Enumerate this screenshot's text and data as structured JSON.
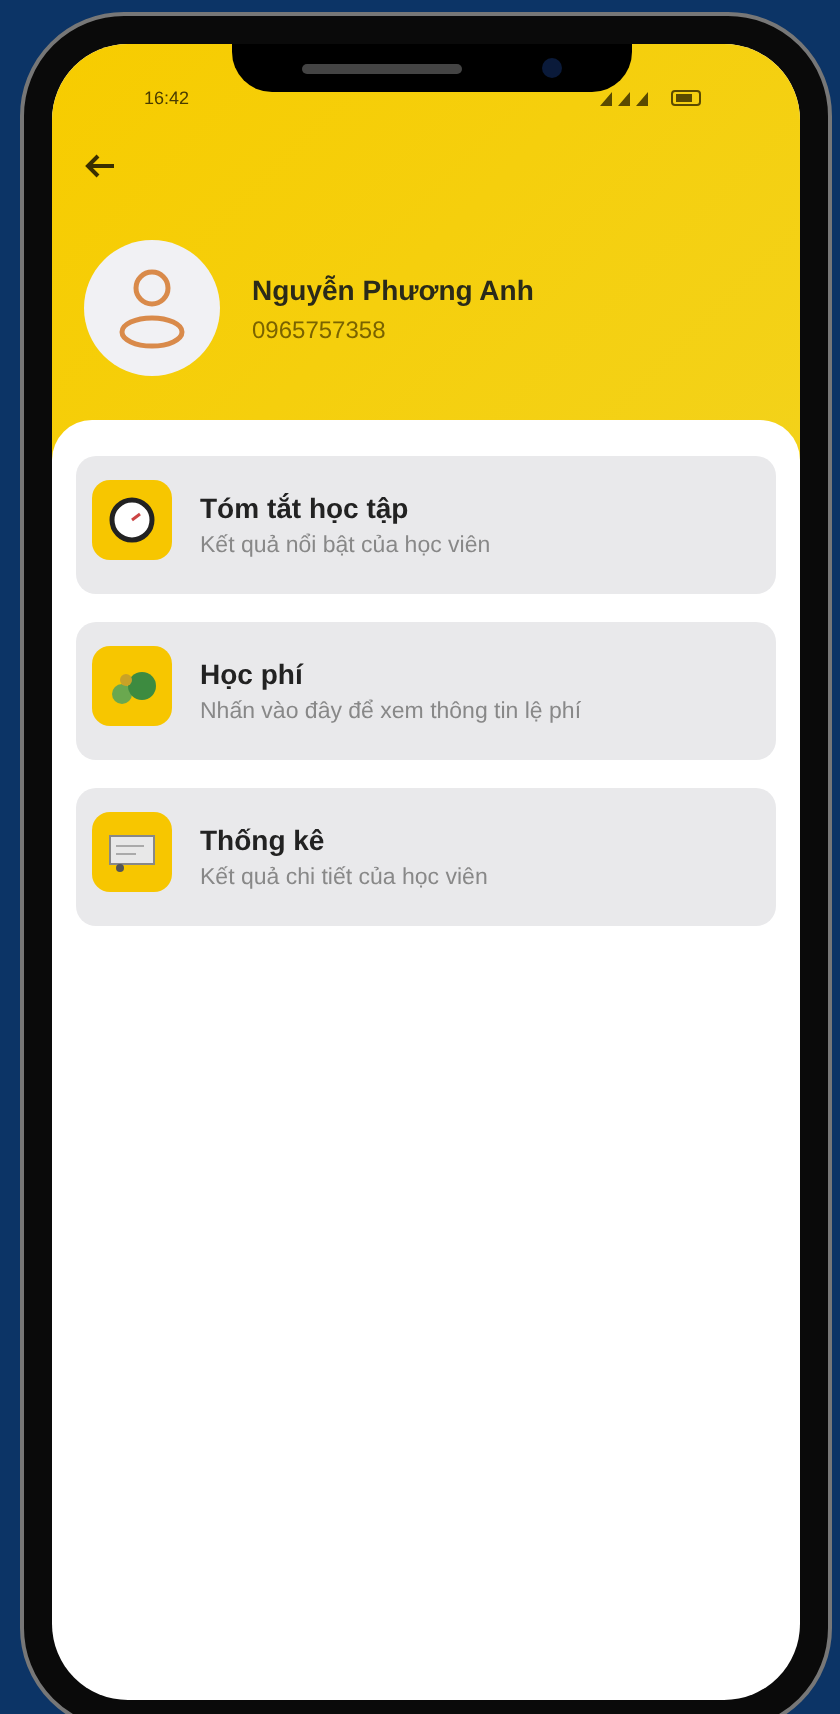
{
  "status_bar": {
    "time": "16:42"
  },
  "profile": {
    "name": "Nguyễn Phương Anh",
    "phone": "0965757358"
  },
  "menu": [
    {
      "kind": "clock",
      "title": "Tóm tắt học tập",
      "subtitle": "Kết quả nổi bật của học viên"
    },
    {
      "kind": "money",
      "title": "Học phí",
      "subtitle": "Nhấn vào đây để xem thông tin lệ phí"
    },
    {
      "kind": "board",
      "title": "Thống kê",
      "subtitle": "Kết quả chi tiết của học viên"
    }
  ]
}
